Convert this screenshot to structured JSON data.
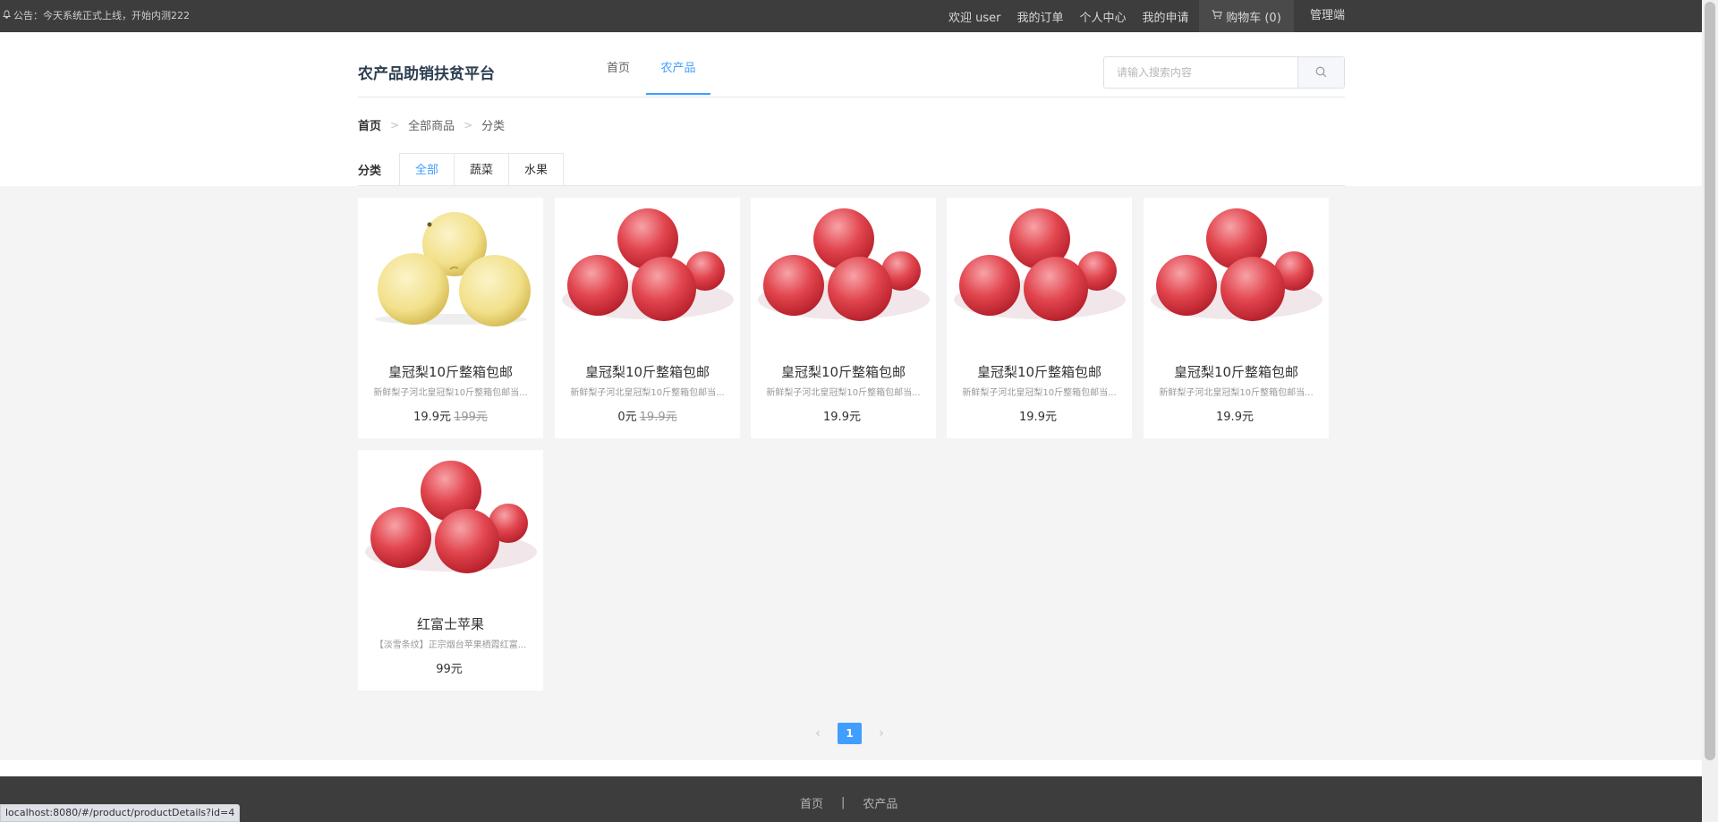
{
  "topbar": {
    "notice": "公告：今天系统正式上线，开始内测222",
    "welcome": "欢迎 user",
    "orders": "我的订单",
    "profile": "个人中心",
    "applications": "我的申请",
    "cart": "购物车 (0)",
    "admin": "管理端"
  },
  "header": {
    "logo": "农产品助销扶贫平台",
    "nav": [
      "首页",
      "农产品"
    ],
    "search_placeholder": "请输入搜索内容"
  },
  "breadcrumb": [
    "首页",
    "全部商品",
    "分类"
  ],
  "category": {
    "label": "分类",
    "tabs": [
      "全部",
      "蔬菜",
      "水果"
    ],
    "active": "全部"
  },
  "products": [
    {
      "name": "皇冠梨10斤整箱包邮",
      "desc": "新鲜梨子河北皇冠梨10斤整箱包邮当...",
      "price": "19.9元",
      "old_price": "199元",
      "image": "pear"
    },
    {
      "name": "皇冠梨10斤整箱包邮",
      "desc": "新鲜梨子河北皇冠梨10斤整箱包邮当...",
      "price": "0元",
      "old_price": "19.9元",
      "image": "apple"
    },
    {
      "name": "皇冠梨10斤整箱包邮",
      "desc": "新鲜梨子河北皇冠梨10斤整箱包邮当...",
      "price": "19.9元",
      "old_price": "",
      "image": "apple"
    },
    {
      "name": "皇冠梨10斤整箱包邮",
      "desc": "新鲜梨子河北皇冠梨10斤整箱包邮当...",
      "price": "19.9元",
      "old_price": "",
      "image": "apple"
    },
    {
      "name": "皇冠梨10斤整箱包邮",
      "desc": "新鲜梨子河北皇冠梨10斤整箱包邮当...",
      "price": "19.9元",
      "old_price": "",
      "image": "apple"
    },
    {
      "name": "红富士苹果",
      "desc": "【淡雪条纹】正宗烟台苹果栖霞红富...",
      "price": "99元",
      "old_price": "",
      "image": "apple"
    }
  ],
  "pagination": {
    "current": "1"
  },
  "footer": {
    "links": [
      "首页",
      "|",
      "农产品"
    ]
  },
  "status_url": "localhost:8080/#/product/productDetails?id=4",
  "colors": {
    "accent": "#409eff",
    "topbar": "#3d3d3d",
    "background": "#f4f4f4"
  }
}
